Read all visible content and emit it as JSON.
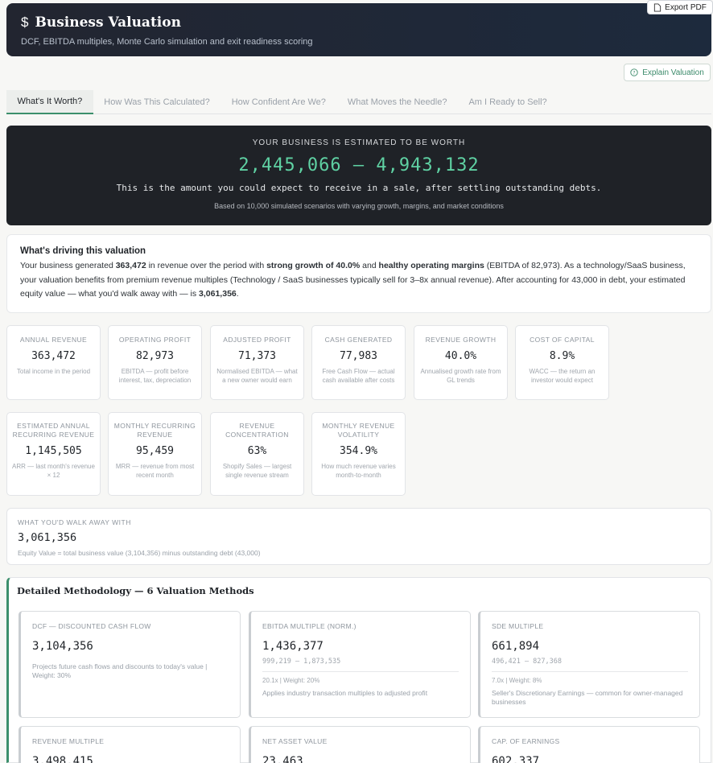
{
  "header": {
    "icon": "dollar-icon",
    "title": "Business Valuation",
    "subtitle": "DCF, EBITDA multiples, Monte Carlo simulation and exit readiness scoring",
    "export_label": "Export PDF",
    "explain_label": "Explain Valuation"
  },
  "tabs": [
    {
      "label": "What's It Worth?",
      "active": true
    },
    {
      "label": "How Was This Calculated?",
      "active": false
    },
    {
      "label": "How Confident Are We?",
      "active": false
    },
    {
      "label": "What Moves the Needle?",
      "active": false
    },
    {
      "label": "Am I Ready to Sell?",
      "active": false
    }
  ],
  "hero": {
    "label": "YOUR BUSINESS IS ESTIMATED TO BE WORTH",
    "range": "2,445,066 — 4,943,132",
    "description": "This is the amount you could expect to receive in a sale, after settling outstanding debts.",
    "note": "Based on 10,000 simulated scenarios with varying growth, margins, and market conditions"
  },
  "driving": {
    "title": "What's driving this valuation",
    "t1": "Your business generated ",
    "revenue": "363,472",
    "t2": " in revenue over the period with ",
    "growth": "strong growth of 40.0%",
    "t3": " and ",
    "margins": "healthy operating margins",
    "t4": " (EBITDA of 82,973). As a technology/SaaS business, your valuation benefits from premium revenue multiples (Technology / SaaS businesses typically sell for 3–8x annual revenue). After accounting for 43,000 in debt, your estimated equity value — what you'd walk away with — is ",
    "equity": "3,061,356",
    "t5": "."
  },
  "metrics_row1": [
    {
      "label": "ANNUAL REVENUE",
      "value": "363,472",
      "desc": "Total income in the period"
    },
    {
      "label": "OPERATING PROFIT",
      "value": "82,973",
      "desc": "EBITDA — profit before interest, tax, depreciation"
    },
    {
      "label": "ADJUSTED PROFIT",
      "value": "71,373",
      "desc": "Normalised EBITDA — what a new owner would earn"
    },
    {
      "label": "CASH GENERATED",
      "value": "77,983",
      "desc": "Free Cash Flow — actual cash available after costs"
    },
    {
      "label": "REVENUE GROWTH",
      "value": "40.0%",
      "desc": "Annualised growth rate from GL trends"
    },
    {
      "label": "COST OF CAPITAL",
      "value": "8.9%",
      "desc": "WACC — the return an investor would expect"
    }
  ],
  "metrics_row2": [
    {
      "label": "ESTIMATED ANNUAL RECURRING REVENUE",
      "value": "1,145,505",
      "desc": "ARR — last month's revenue × 12"
    },
    {
      "label": "MONTHLY RECURRING REVENUE",
      "value": "95,459",
      "desc": "MRR — revenue from most recent month"
    },
    {
      "label": "REVENUE CONCENTRATION",
      "value": "63%",
      "desc": "Shopify Sales — largest single revenue stream"
    },
    {
      "label": "MONTHLY REVENUE VOLATILITY",
      "value": "354.9%",
      "desc": "How much revenue varies month-to-month"
    }
  ],
  "walk": {
    "label": "WHAT YOU'D WALK AWAY WITH",
    "value": "3,061,356",
    "note": "Equity Value = total business value (3,104,356) minus outstanding debt (43,000)"
  },
  "methodology": {
    "title": "Detailed Methodology — 6 Valuation Methods",
    "cards": [
      {
        "label": "DCF — DISCOUNTED CASH FLOW",
        "value": "3,104,356",
        "range": "",
        "weight": "",
        "desc": "Projects future cash flows and discounts to today's value | Weight: 30%"
      },
      {
        "label": "EBITDA MULTIPLE (NORM.)",
        "value": "1,436,377",
        "range": "999,219 — 1,873,535",
        "weight": "20.1x | Weight: 20%",
        "desc": "Applies industry transaction multiples to adjusted profit"
      },
      {
        "label": "SDE MULTIPLE",
        "value": "661,894",
        "range": "496,421 — 827,368",
        "weight": "7.0x | Weight: 8%",
        "desc": "Seller's Discretionary Earnings — common for owner-managed businesses"
      },
      {
        "label": "REVENUE MULTIPLE",
        "value": "3,498,415"
      },
      {
        "label": "NET ASSET VALUE",
        "value": "23,463"
      },
      {
        "label": "CAP. OF EARNINGS",
        "value": "602,337"
      }
    ]
  },
  "colors": {
    "accent": "#3c8f6c",
    "hero_value": "#5fd1a3",
    "header_bg": "#222530"
  }
}
